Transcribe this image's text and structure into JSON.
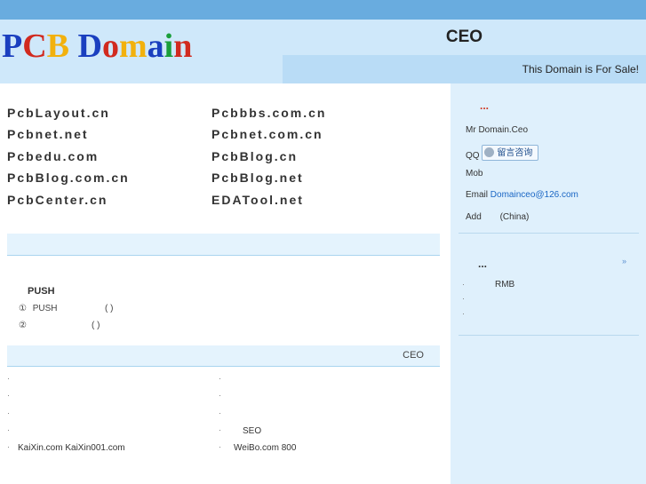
{
  "header": {
    "logo_letters": [
      {
        "char": "P",
        "color": "#1a3fbf"
      },
      {
        "char": "C",
        "color": "#d12a1f"
      },
      {
        "char": "B",
        "color": "#f2b10d"
      },
      {
        "char": " ",
        "color": "#000000"
      },
      {
        "char": "D",
        "color": "#1a3fbf"
      },
      {
        "char": "o",
        "color": "#d12a1f"
      },
      {
        "char": "m",
        "color": "#f2b10d"
      },
      {
        "char": "a",
        "color": "#1a3fbf"
      },
      {
        "char": "i",
        "color": "#1a9e3a"
      },
      {
        "char": "n",
        "color": "#d12a1f"
      }
    ],
    "ceo_title": "CEO",
    "sale_text": "This Domain is For Sale!"
  },
  "domains": {
    "col1": [
      "PcbLayout.cn",
      "Pcbnet.net",
      "Pcbedu.com",
      "PcbBlog.com.cn",
      "PcbCenter.cn"
    ],
    "col2": [
      "Pcbbbs.com.cn",
      "Pcbnet.com.cn",
      "PcbBlog.cn",
      "PcbBlog.net",
      "EDATool.net"
    ]
  },
  "push": {
    "title": "PUSH",
    "line1_num": "①",
    "line1_text": "PUSH",
    "line1_paren": "( )",
    "line2_num": "②",
    "line2_paren": "( )"
  },
  "band2": {
    "ceo_label": "CEO"
  },
  "links": {
    "left_bullet": "·",
    "right_bullet": "·",
    "left_last": "KaiXin.com KaiXin001.com",
    "right_seo": "SEO",
    "right_last": "WeiBo.com  800"
  },
  "sidebar": {
    "contact_heading": "...",
    "name": "Mr Domain.Ceo",
    "qq_label": "QQ",
    "qq_button": "留言咨询",
    "mob_label": "Mob",
    "email_label": "Email",
    "email": "Domainceo@126.com",
    "add_label": "Add",
    "add_value": "(China)",
    "section2_heading": "...",
    "more": "»",
    "rmb": "RMB",
    "bullet": "·"
  },
  "colors": {
    "topbar": "#69acdf",
    "header": "#cfe8fa",
    "sale_bar": "#b9dcf6",
    "sidebar": "#dff0fc",
    "band": "#e4f3fd"
  }
}
